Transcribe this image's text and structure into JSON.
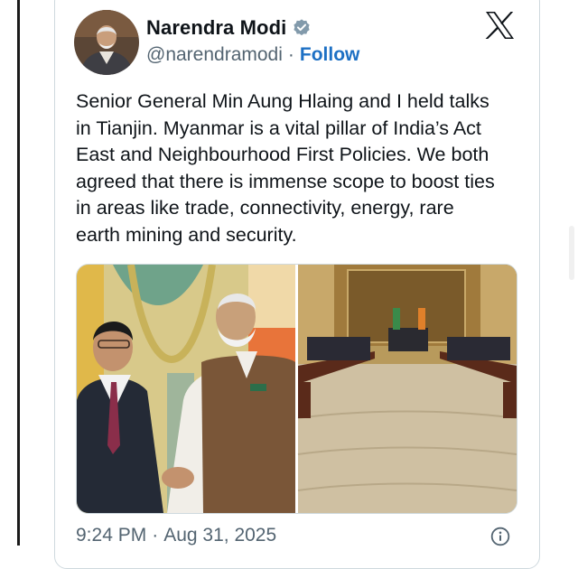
{
  "tweet": {
    "author_name": "Narendra Modi",
    "handle": "@narendramodi",
    "separator": "·",
    "follow_label": "Follow",
    "text_lines": [
      "Senior General Min Aung Hlaing and I held talks",
      "in Tianjin. Myanmar is a vital pillar of India’s Act",
      "East and Neighbourhood First Policies. We both",
      "agreed that there is immense scope to boost ties",
      "in areas like trade, connectivity, energy, rare",
      "earth mining and security."
    ],
    "time": "9:24 PM",
    "date": "Aug 31, 2025"
  },
  "icons": {
    "verified": "verified-badge-icon",
    "platform": "x-logo-icon",
    "info": "info-icon"
  },
  "colors": {
    "link": "#1d70c4",
    "secondary_text": "#536471",
    "verified_badge": "#829aab",
    "border": "#cfd9de"
  }
}
